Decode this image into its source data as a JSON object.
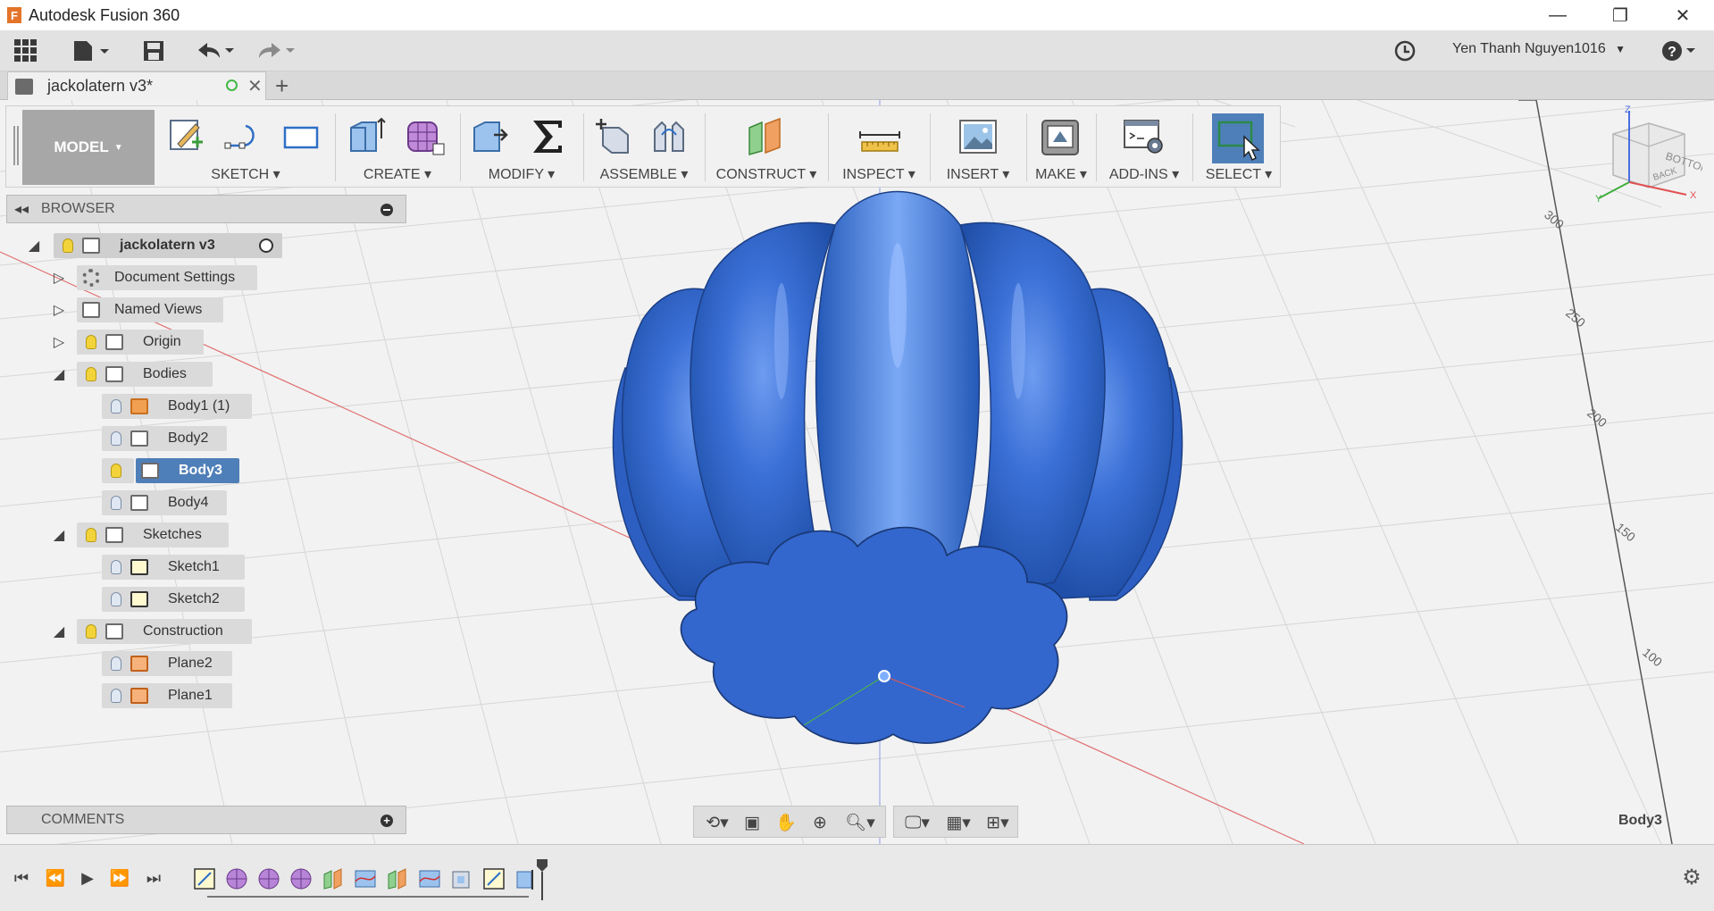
{
  "window": {
    "app_title": "Autodesk Fusion 360",
    "logo_letter": "F",
    "minimize_glyph": "—",
    "restore_glyph": "❐",
    "close_glyph": "✕"
  },
  "quick_access": {
    "user_name": "Yen Thanh Nguyen1016",
    "user_caret": "▼",
    "help_glyph": "?",
    "icons": [
      "apps-grid-icon",
      "file-icon",
      "save-icon",
      "undo-icon",
      "redo-icon",
      "clock-icon",
      "help-icon"
    ]
  },
  "document_tab": {
    "name": "jackolatern v3*",
    "close_glyph": "✕",
    "new_tab_glyph": "+"
  },
  "ribbon": {
    "workspace": "MODEL",
    "groups": [
      {
        "label": "SKETCH"
      },
      {
        "label": "CREATE"
      },
      {
        "label": "MODIFY"
      },
      {
        "label": "ASSEMBLE"
      },
      {
        "label": "CONSTRUCT"
      },
      {
        "label": "INSPECT"
      },
      {
        "label": "INSERT"
      },
      {
        "label": "MAKE"
      },
      {
        "label": "ADD-INS"
      },
      {
        "label": "SELECT"
      }
    ]
  },
  "browser": {
    "title": "BROWSER",
    "collapse_glyph": "◂◂",
    "root": "jackolatern v3",
    "nodes": [
      {
        "label": "Document Settings"
      },
      {
        "label": "Named Views"
      },
      {
        "label": "Origin"
      },
      {
        "label": "Bodies"
      },
      {
        "label": "Body1 (1)"
      },
      {
        "label": "Body2"
      },
      {
        "label": "Body3"
      },
      {
        "label": "Body4"
      },
      {
        "label": "Sketches"
      },
      {
        "label": "Sketch1"
      },
      {
        "label": "Sketch2"
      },
      {
        "label": "Construction"
      },
      {
        "label": "Plane2"
      },
      {
        "label": "Plane1"
      }
    ]
  },
  "comments": {
    "title": "COMMENTS",
    "add_glyph": "+"
  },
  "viewport": {
    "selected_label": "Body3",
    "ruler_ticks": [
      "300",
      "250",
      "200",
      "150",
      "100"
    ],
    "viewcube_faces": [
      "BOTTOM",
      "BACK"
    ],
    "axis_labels": [
      "Z",
      "X",
      "Y"
    ],
    "colors": {
      "body": "#2f66cc",
      "background": "#f2f2f2",
      "grid": "#d8d8d8",
      "red_axis": "#e06c6c",
      "selection": "#4f7fb8"
    }
  },
  "timeline": {
    "settings_icon": "gear-icon"
  }
}
